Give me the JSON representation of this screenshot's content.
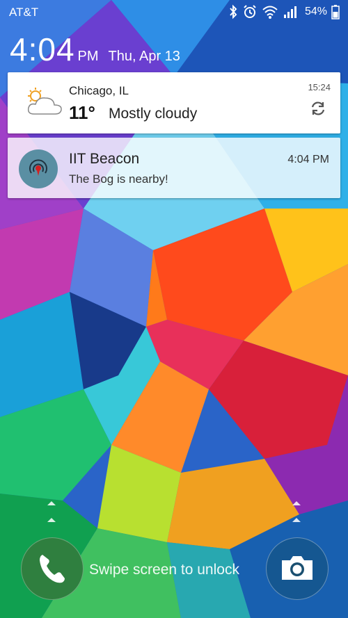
{
  "status_bar": {
    "carrier": "AT&T",
    "battery_percent": "54%",
    "icons": [
      "bluetooth-icon",
      "alarm-icon",
      "wifi-icon",
      "signal-icon",
      "battery-icon"
    ]
  },
  "clock": {
    "time": "4:04",
    "ampm": "PM",
    "date": "Thu, Apr 13"
  },
  "weather": {
    "city": "Chicago, IL",
    "temperature": "11°",
    "condition": "Mostly cloudy",
    "updated": "15:24",
    "icon": "partly-cloudy-icon"
  },
  "notification": {
    "title": "IIT Beacon",
    "text": "The Bog is nearby!",
    "time": "4:04 PM",
    "icon": "beacon-icon"
  },
  "lockscreen": {
    "unlock_hint": "Swipe screen to unlock",
    "left_shortcut": "phone-icon",
    "right_shortcut": "camera-icon"
  },
  "colors": {
    "notification_card": "#ffffff",
    "phone_button": "#2f7f3f",
    "beacon_icon_bg": "#5a8fa3",
    "beacon_icon_mark": "#d32020"
  }
}
